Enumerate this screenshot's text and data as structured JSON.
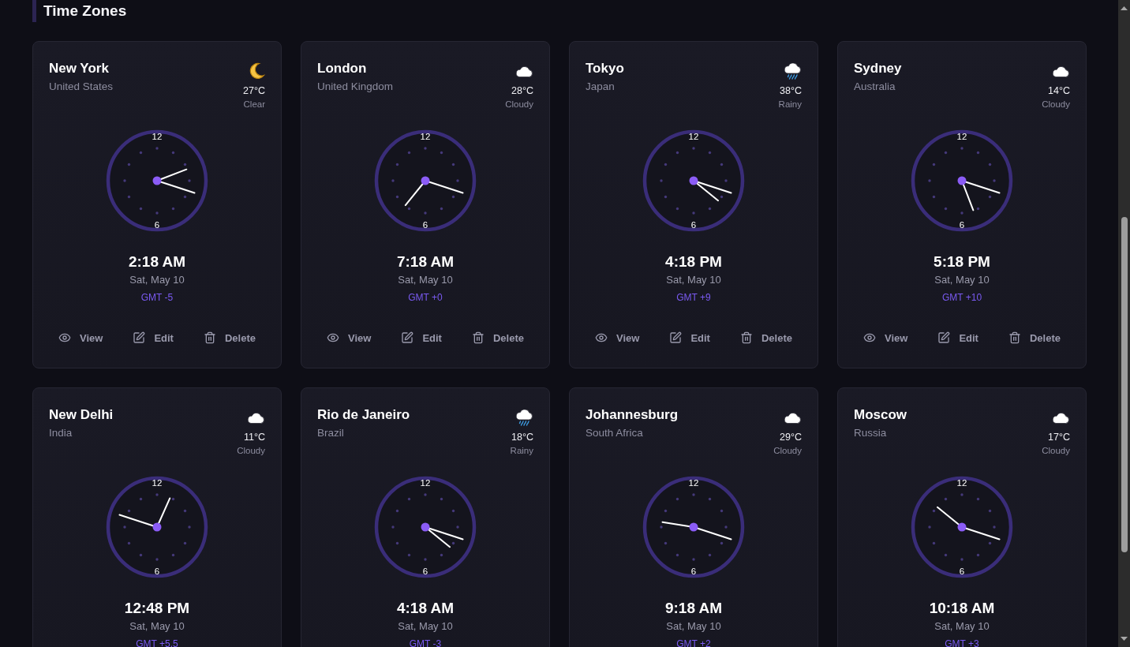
{
  "header": {
    "title": "Time Zones"
  },
  "cities": [
    {
      "name": "New York",
      "country": "United States",
      "weather": {
        "kind": "clear",
        "temperature": "27°C",
        "condition": "Clear"
      },
      "clock": {
        "numerals": [
          "12",
          "6"
        ]
      },
      "time": "2:18 AM",
      "date": "Sat, May 10",
      "offset": "GMT -5",
      "actions": [
        {
          "kind": "view",
          "label": "View"
        },
        {
          "kind": "edit",
          "label": "Edit"
        },
        {
          "kind": "delete",
          "label": "Delete"
        }
      ]
    },
    {
      "name": "London",
      "country": "United Kingdom",
      "weather": {
        "kind": "cloudy",
        "temperature": "28°C",
        "condition": "Cloudy"
      },
      "clock": {
        "numerals": [
          "12",
          "6"
        ]
      },
      "time": "7:18 AM",
      "date": "Sat, May 10",
      "offset": "GMT +0",
      "actions": [
        {
          "kind": "view",
          "label": "View"
        },
        {
          "kind": "edit",
          "label": "Edit"
        },
        {
          "kind": "delete",
          "label": "Delete"
        }
      ]
    },
    {
      "name": "Tokyo",
      "country": "Japan",
      "weather": {
        "kind": "rainy",
        "temperature": "38°C",
        "condition": "Rainy"
      },
      "clock": {
        "numerals": [
          "12",
          "6"
        ]
      },
      "time": "4:18 PM",
      "date": "Sat, May 10",
      "offset": "GMT +9",
      "actions": [
        {
          "kind": "view",
          "label": "View"
        },
        {
          "kind": "edit",
          "label": "Edit"
        },
        {
          "kind": "delete",
          "label": "Delete"
        }
      ]
    },
    {
      "name": "Sydney",
      "country": "Australia",
      "weather": {
        "kind": "cloudy",
        "temperature": "14°C",
        "condition": "Cloudy"
      },
      "clock": {
        "numerals": [
          "12",
          "6"
        ]
      },
      "time": "5:18 PM",
      "date": "Sat, May 10",
      "offset": "GMT +10",
      "actions": [
        {
          "kind": "view",
          "label": "View"
        },
        {
          "kind": "edit",
          "label": "Edit"
        },
        {
          "kind": "delete",
          "label": "Delete"
        }
      ]
    },
    {
      "name": "New Delhi",
      "country": "India",
      "weather": {
        "kind": "cloudy",
        "temperature": "11°C",
        "condition": "Cloudy"
      },
      "clock": {
        "numerals": [
          "12",
          "6"
        ]
      },
      "time": "12:48 PM",
      "date": "Sat, May 10",
      "offset": "GMT +5.5"
    },
    {
      "name": "Rio de Janeiro",
      "country": "Brazil",
      "weather": {
        "kind": "rainy",
        "temperature": "18°C",
        "condition": "Rainy"
      },
      "clock": {
        "numerals": [
          "12",
          "6"
        ]
      },
      "time": "4:18 AM",
      "date": "Sat, May 10",
      "offset": "GMT -3"
    },
    {
      "name": "Johannesburg",
      "country": "South Africa",
      "weather": {
        "kind": "cloudy",
        "temperature": "29°C",
        "condition": "Cloudy"
      },
      "clock": {
        "numerals": [
          "12",
          "6"
        ]
      },
      "time": "9:18 AM",
      "date": "Sat, May 10",
      "offset": "GMT +2"
    },
    {
      "name": "Moscow",
      "country": "Russia",
      "weather": {
        "kind": "cloudy",
        "temperature": "17°C",
        "condition": "Cloudy"
      },
      "clock": {
        "numerals": [
          "12",
          "6"
        ]
      },
      "time": "10:18 AM",
      "date": "Sat, May 10",
      "offset": "GMT +3"
    }
  ]
}
